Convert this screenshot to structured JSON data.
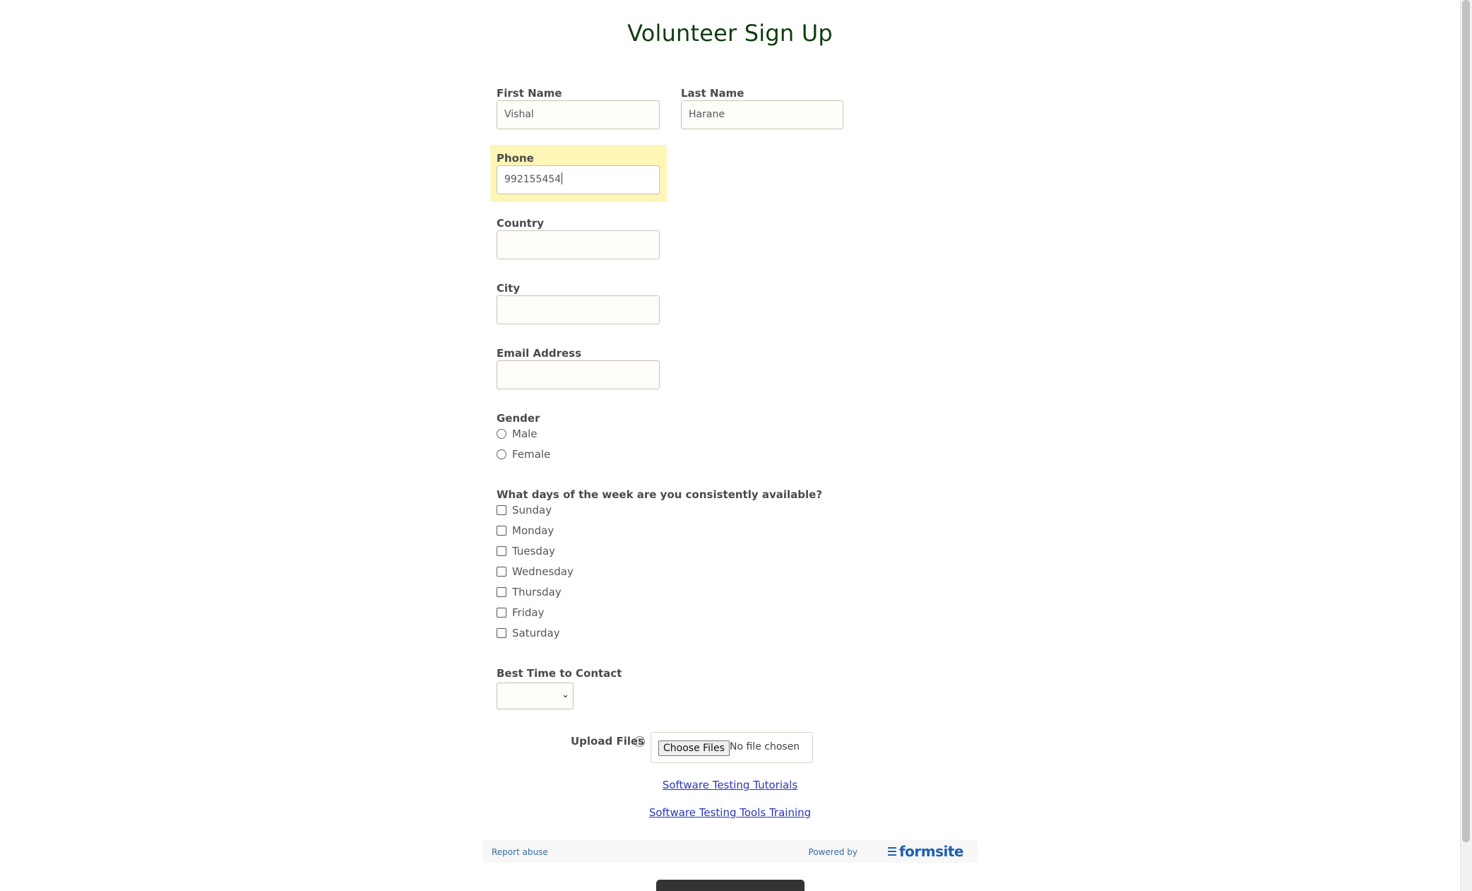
{
  "form": {
    "title": "Volunteer Sign Up",
    "first_name": {
      "label": "First Name",
      "value": "Vishal"
    },
    "last_name": {
      "label": "Last Name",
      "value": "Harane"
    },
    "phone": {
      "label": "Phone",
      "value": "992155454"
    },
    "country": {
      "label": "Country",
      "value": ""
    },
    "city": {
      "label": "City",
      "value": ""
    },
    "email": {
      "label": "Email Address",
      "value": ""
    },
    "gender": {
      "label": "Gender",
      "options": [
        "Male",
        "Female"
      ]
    },
    "days": {
      "label": "What days of the week are you consistently available?",
      "options": [
        "Sunday",
        "Monday",
        "Tuesday",
        "Wednesday",
        "Thursday",
        "Friday",
        "Saturday"
      ]
    },
    "best_time": {
      "label": "Best Time to Contact",
      "value": ""
    },
    "upload": {
      "label": "Upload Files",
      "help_icon": "?",
      "button": "Choose Files",
      "status": "No file chosen"
    }
  },
  "links": {
    "tutorials": "Software Testing Tutorials",
    "training": "Software Testing Tools Training"
  },
  "footer": {
    "report": "Report abuse",
    "powered": "Powered by",
    "brand": "formsite"
  },
  "colors": {
    "highlight": "#fdf6b7",
    "title": "#0f3d0f",
    "link": "#2a35b8"
  }
}
